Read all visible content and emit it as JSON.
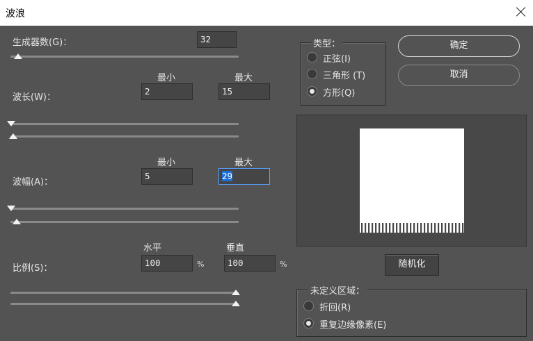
{
  "window": {
    "title": "波浪"
  },
  "generators": {
    "label": "生成器数(G)：",
    "value": "32",
    "slider_fraction": 0.02
  },
  "wavelength": {
    "label": "波长(W)：",
    "min_header": "最小",
    "max_header": "最大",
    "min_value": "2",
    "max_value": "15",
    "min_slider_fraction": 0.0,
    "max_slider_fraction": 0.01
  },
  "amplitude": {
    "label": "波幅(A)：",
    "min_header": "最小",
    "max_header": "最大",
    "min_value": "5",
    "max_value": "29",
    "min_slider_fraction": 0.0,
    "max_slider_fraction": 0.03
  },
  "scale": {
    "label": "比例(S)：",
    "horizontal_header": "水平",
    "vertical_header": "垂直",
    "horizontal_value": "100",
    "vertical_value": "100",
    "unit": "%",
    "horizontal_slider_fraction": 1.0,
    "vertical_slider_fraction": 1.0
  },
  "type": {
    "legend": "类型：",
    "options": [
      {
        "label": "正弦(I)",
        "selected": false
      },
      {
        "label": "三角形 (T)",
        "selected": false
      },
      {
        "label": "方形(Q)",
        "selected": true
      }
    ]
  },
  "buttons": {
    "ok": "确定",
    "cancel": "取消",
    "randomize": "随机化"
  },
  "undefined_areas": {
    "legend": "未定义区域：",
    "options": [
      {
        "label": "折回(R)",
        "selected": false
      },
      {
        "label": "重复边缘像素(E)",
        "selected": true
      }
    ]
  }
}
